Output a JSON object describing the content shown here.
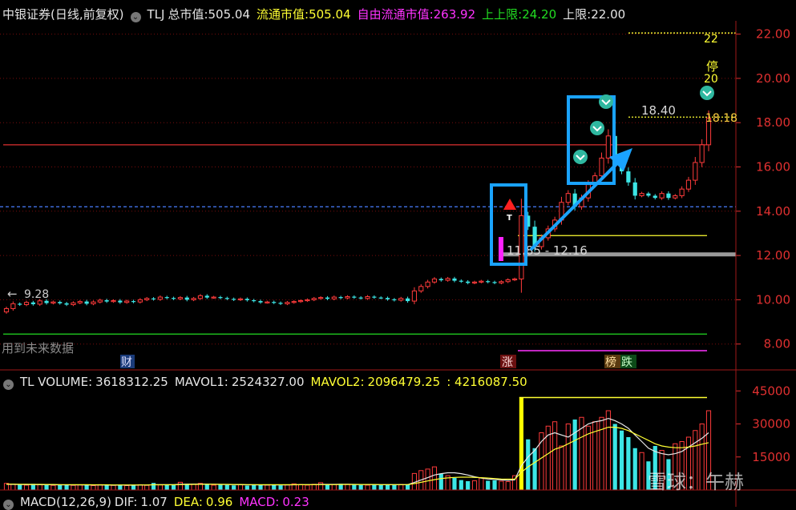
{
  "header": {
    "stock_name": "中银证券",
    "mode": "(日线,前复权)",
    "ticker": "TLJ",
    "total_cap_label": "总市值:",
    "total_cap": "505.04",
    "float_cap_label": "流通市值:",
    "float_cap": "505.04",
    "free_float_label": "自由流通市值:",
    "free_float": "263.92",
    "upper_label": "上上限:",
    "upper": "24.20",
    "upper2_label": "上限:",
    "upper2": "22.00"
  },
  "volume_header": {
    "name": "TL VOLUME:",
    "volume": "3618312.25",
    "mavol1_label": "MAVOL1:",
    "mavol1": "2524327.00",
    "mavol2_label": "MAVOL2:",
    "mavol2": "2096479.25",
    "extra": ": 4216087.50"
  },
  "macd_header": {
    "name": "MACD(12,26,9)",
    "dif_label": "DIF:",
    "dif": "1.07",
    "dea_label": "DEA:",
    "dea": "0.96",
    "macd_label": "MACD:",
    "macd": "0.23"
  },
  "annotations": {
    "future_data": "用到未来数据",
    "low_price": "9.28",
    "range_text": "11.85 - 12.16",
    "price_18_40": "18.40",
    "price_18_18": "18.18",
    "limit_22": "22",
    "stop_label": "停",
    "limit_20": "20",
    "t_marker": "T",
    "tag_cai": "财",
    "tag_zhang": "涨",
    "tag_bang": "榜",
    "tag_die": "跌",
    "watermark": "雪球：午赫"
  },
  "colors": {
    "up": "#ff3b3b",
    "down": "#3ce6e6",
    "axis": "#e03030",
    "highlight_box": "#1aa3ff",
    "limit_line": "#ffff33",
    "support_line": "#22dd22"
  },
  "chart_data": [
    {
      "type": "candlestick",
      "title": "中银证券 (日线,前复权)",
      "y_ticks": [
        8.0,
        10.0,
        12.0,
        14.0,
        16.0,
        18.0,
        20.0,
        22.0
      ],
      "ylim": [
        7.7,
        22.6
      ],
      "reference_lines": [
        {
          "value": 17.0,
          "style": "solid",
          "color": "#e03030"
        },
        {
          "value": 14.2,
          "style": "dashed",
          "color": "#4a7fff"
        },
        {
          "value": 12.9,
          "style": "solid",
          "color": "#ffff33"
        },
        {
          "value": 12.05,
          "style": "band",
          "color": "#9a9a9a"
        },
        {
          "value": 8.45,
          "style": "solid",
          "color": "#22dd22"
        },
        {
          "value": 22.05,
          "style": "dotted",
          "color": "#ffff33"
        },
        {
          "value": 18.25,
          "style": "dotted",
          "color": "#ffff33"
        }
      ],
      "closes": [
        9.6,
        9.82,
        9.78,
        9.88,
        9.8,
        9.95,
        9.85,
        9.9,
        9.84,
        9.78,
        9.86,
        9.92,
        9.82,
        9.9,
        9.98,
        9.92,
        9.96,
        9.88,
        9.94,
        9.9,
        10.0,
        10.06,
        10.02,
        10.12,
        10.08,
        10.04,
        10.1,
        10.0,
        10.06,
        10.18,
        10.1,
        10.12,
        10.08,
        10.04,
        10.0,
        10.04,
        9.98,
        9.94,
        9.88,
        9.9,
        9.86,
        9.82,
        9.88,
        9.92,
        9.96,
        10.0,
        10.06,
        10.1,
        10.04,
        10.12,
        10.08,
        10.14,
        10.1,
        10.06,
        10.14,
        10.1,
        10.08,
        10.02,
        9.98,
        10.06,
        9.94,
        10.4,
        10.6,
        10.8,
        10.94,
        10.88,
        10.96,
        10.86,
        10.82,
        10.76,
        10.8,
        10.84,
        10.8,
        10.76,
        10.82,
        10.9,
        10.94,
        13.8,
        13.3,
        12.4,
        12.8,
        13.2,
        13.6,
        14.4,
        14.8,
        14.2,
        14.6,
        15.2,
        15.6,
        16.4,
        17.4,
        16.2,
        15.8,
        15.3,
        14.7,
        14.8,
        14.7,
        14.6,
        14.8,
        14.6,
        14.7,
        15.0,
        15.4,
        16.2,
        17.0,
        18.2
      ],
      "volume": {
        "y_ticks": [
          15000,
          30000,
          45000
        ],
        "ylim": [
          0,
          48000
        ],
        "values": [
          3000,
          2600,
          2400,
          2200,
          2800,
          2500,
          2300,
          2100,
          2500,
          2400,
          2100,
          2300,
          2200,
          2000,
          2400,
          2200,
          2100,
          2300,
          2000,
          2200,
          2400,
          2100,
          3200,
          2300,
          2500,
          2200,
          3500,
          2800,
          2600,
          3000,
          2400,
          2200,
          2500,
          2300,
          2100,
          2400,
          2000,
          2300,
          2500,
          2200,
          2400,
          2100,
          2300,
          2800,
          2500,
          2200,
          2600,
          3300,
          2400,
          2500,
          2800,
          2600,
          2400,
          2300,
          2200,
          2500,
          2400,
          2300,
          2200,
          2500,
          2600,
          7500,
          8800,
          9500,
          10500,
          7500,
          6500,
          5500,
          4500,
          4000,
          4200,
          5500,
          4200,
          4400,
          4000,
          3800,
          6500,
          42000,
          23000,
          19000,
          26000,
          29000,
          31000,
          20000,
          30000,
          32000,
          33000,
          29000,
          31000,
          33000,
          36000,
          30000,
          27000,
          24000,
          19000,
          17000,
          13000,
          20000,
          18000,
          14000,
          21000,
          22000,
          24000,
          27000,
          30000,
          36000
        ],
        "mavol1": [
          2600,
          2550,
          2500,
          2450,
          2450,
          2400,
          2400,
          2350,
          2350,
          2300,
          2300,
          2300,
          2250,
          2250,
          2250,
          2250,
          2200,
          2250,
          2200,
          2200,
          2250,
          2250,
          2400,
          2400,
          2450,
          2400,
          2600,
          2650,
          2700,
          2700,
          2650,
          2600,
          2550,
          2500,
          2450,
          2400,
          2350,
          2350,
          2300,
          2300,
          2300,
          2300,
          2300,
          2350,
          2400,
          2400,
          2450,
          2550,
          2550,
          2550,
          2600,
          2600,
          2550,
          2500,
          2500,
          2450,
          2450,
          2400,
          2400,
          2400,
          2450,
          3400,
          4600,
          5600,
          6800,
          7400,
          7800,
          7800,
          7400,
          6800,
          6000,
          5400,
          5000,
          4800,
          4600,
          4400,
          4600,
          11000,
          15000,
          18000,
          22000,
          25000,
          26000,
          25000,
          24000,
          26000,
          28000,
          30000,
          31000,
          31500,
          32500,
          31500,
          30000,
          28000,
          25000,
          22000,
          19000,
          17500,
          16500,
          16000,
          16500,
          17500,
          19500,
          21500,
          23500,
          26000
        ],
        "mavol2": [
          2700,
          2650,
          2600,
          2600,
          2550,
          2550,
          2500,
          2500,
          2450,
          2450,
          2400,
          2400,
          2400,
          2350,
          2350,
          2350,
          2300,
          2300,
          2300,
          2300,
          2300,
          2300,
          2350,
          2350,
          2350,
          2350,
          2450,
          2500,
          2550,
          2600,
          2600,
          2600,
          2550,
          2550,
          2500,
          2500,
          2450,
          2450,
          2400,
          2400,
          2400,
          2400,
          2400,
          2400,
          2400,
          2400,
          2400,
          2450,
          2450,
          2450,
          2500,
          2500,
          2500,
          2500,
          2500,
          2500,
          2450,
          2450,
          2450,
          2450,
          2450,
          2900,
          3500,
          4100,
          4700,
          5200,
          5500,
          5700,
          5800,
          5800,
          5700,
          5600,
          5400,
          5200,
          5000,
          4900,
          4900,
          8000,
          10500,
          12500,
          14500,
          16500,
          18500,
          19500,
          21000,
          22500,
          24000,
          25500,
          26500,
          27500,
          28500,
          28500,
          28000,
          27000,
          25500,
          24000,
          22500,
          21000,
          20000,
          19500,
          19200,
          19200,
          19500,
          20000,
          20800,
          21500
        ]
      }
    }
  ]
}
